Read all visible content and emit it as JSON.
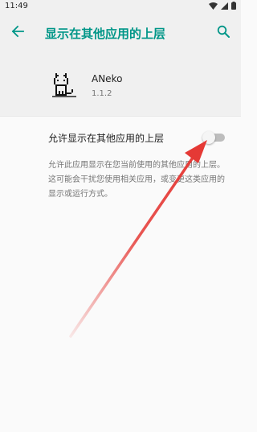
{
  "status_bar": {
    "time": "11:49",
    "icons": [
      "wifi-icon",
      "signal-icon",
      "battery-icon"
    ]
  },
  "app_bar": {
    "title": "显示在其他应用的上层",
    "back_icon": "arrow-left-icon",
    "search_icon": "search-icon"
  },
  "app": {
    "name": "ANeko",
    "version": "1.1.2",
    "icon": "pixel-cat-icon"
  },
  "setting": {
    "label": "允许显示在其他应用的上层",
    "enabled": false
  },
  "description": "允许此应用显示在您当前使用的其他应用的上层。这可能会干扰您使用相关应用，或变更这类应用的显示或运行方式。",
  "colors": {
    "accent": "#009688",
    "background": "#fafafa",
    "header_bg": "#f0f0f0",
    "annotation_arrow": "#e53935"
  }
}
